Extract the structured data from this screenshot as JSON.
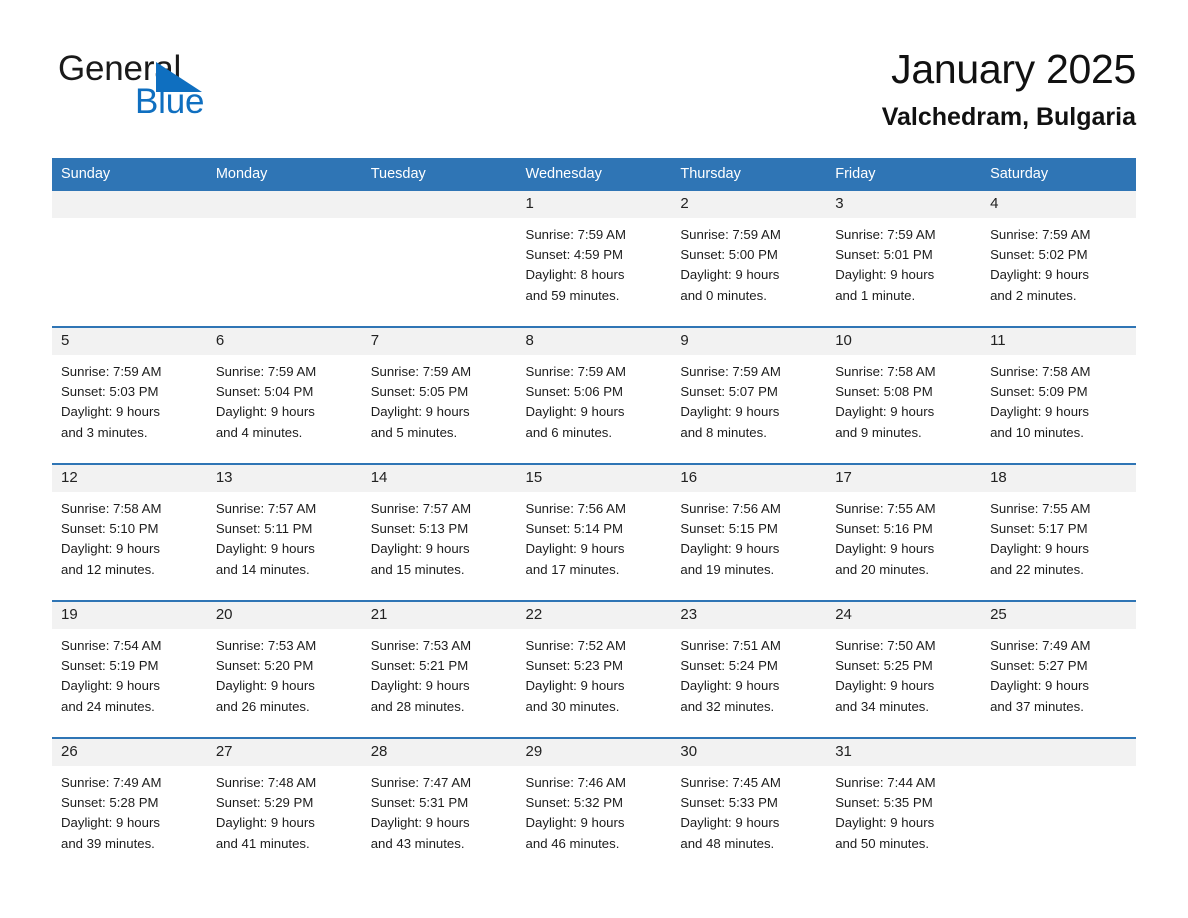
{
  "brand": {
    "line1": "General",
    "line2": "Blue",
    "flag_icon": "blue-triangle-flag-icon",
    "accent_color": "#0f6fc0"
  },
  "header": {
    "title": "January 2025",
    "location": "Valchedram, Bulgaria"
  },
  "colors": {
    "header_blue": "#2f75b5",
    "daynum_gray": "#f2f2f2",
    "text": "#1c1c1c"
  },
  "calendar": {
    "weekday_headers": [
      "Sunday",
      "Monday",
      "Tuesday",
      "Wednesday",
      "Thursday",
      "Friday",
      "Saturday"
    ],
    "weeks": [
      [
        {
          "day": "",
          "sunrise": "",
          "sunset": "",
          "daylight_line1": "",
          "daylight_line2": ""
        },
        {
          "day": "",
          "sunrise": "",
          "sunset": "",
          "daylight_line1": "",
          "daylight_line2": ""
        },
        {
          "day": "",
          "sunrise": "",
          "sunset": "",
          "daylight_line1": "",
          "daylight_line2": ""
        },
        {
          "day": "1",
          "sunrise": "Sunrise: 7:59 AM",
          "sunset": "Sunset: 4:59 PM",
          "daylight_line1": "Daylight: 8 hours",
          "daylight_line2": "and 59 minutes."
        },
        {
          "day": "2",
          "sunrise": "Sunrise: 7:59 AM",
          "sunset": "Sunset: 5:00 PM",
          "daylight_line1": "Daylight: 9 hours",
          "daylight_line2": "and 0 minutes."
        },
        {
          "day": "3",
          "sunrise": "Sunrise: 7:59 AM",
          "sunset": "Sunset: 5:01 PM",
          "daylight_line1": "Daylight: 9 hours",
          "daylight_line2": "and 1 minute."
        },
        {
          "day": "4",
          "sunrise": "Sunrise: 7:59 AM",
          "sunset": "Sunset: 5:02 PM",
          "daylight_line1": "Daylight: 9 hours",
          "daylight_line2": "and 2 minutes."
        }
      ],
      [
        {
          "day": "5",
          "sunrise": "Sunrise: 7:59 AM",
          "sunset": "Sunset: 5:03 PM",
          "daylight_line1": "Daylight: 9 hours",
          "daylight_line2": "and 3 minutes."
        },
        {
          "day": "6",
          "sunrise": "Sunrise: 7:59 AM",
          "sunset": "Sunset: 5:04 PM",
          "daylight_line1": "Daylight: 9 hours",
          "daylight_line2": "and 4 minutes."
        },
        {
          "day": "7",
          "sunrise": "Sunrise: 7:59 AM",
          "sunset": "Sunset: 5:05 PM",
          "daylight_line1": "Daylight: 9 hours",
          "daylight_line2": "and 5 minutes."
        },
        {
          "day": "8",
          "sunrise": "Sunrise: 7:59 AM",
          "sunset": "Sunset: 5:06 PM",
          "daylight_line1": "Daylight: 9 hours",
          "daylight_line2": "and 6 minutes."
        },
        {
          "day": "9",
          "sunrise": "Sunrise: 7:59 AM",
          "sunset": "Sunset: 5:07 PM",
          "daylight_line1": "Daylight: 9 hours",
          "daylight_line2": "and 8 minutes."
        },
        {
          "day": "10",
          "sunrise": "Sunrise: 7:58 AM",
          "sunset": "Sunset: 5:08 PM",
          "daylight_line1": "Daylight: 9 hours",
          "daylight_line2": "and 9 minutes."
        },
        {
          "day": "11",
          "sunrise": "Sunrise: 7:58 AM",
          "sunset": "Sunset: 5:09 PM",
          "daylight_line1": "Daylight: 9 hours",
          "daylight_line2": "and 10 minutes."
        }
      ],
      [
        {
          "day": "12",
          "sunrise": "Sunrise: 7:58 AM",
          "sunset": "Sunset: 5:10 PM",
          "daylight_line1": "Daylight: 9 hours",
          "daylight_line2": "and 12 minutes."
        },
        {
          "day": "13",
          "sunrise": "Sunrise: 7:57 AM",
          "sunset": "Sunset: 5:11 PM",
          "daylight_line1": "Daylight: 9 hours",
          "daylight_line2": "and 14 minutes."
        },
        {
          "day": "14",
          "sunrise": "Sunrise: 7:57 AM",
          "sunset": "Sunset: 5:13 PM",
          "daylight_line1": "Daylight: 9 hours",
          "daylight_line2": "and 15 minutes."
        },
        {
          "day": "15",
          "sunrise": "Sunrise: 7:56 AM",
          "sunset": "Sunset: 5:14 PM",
          "daylight_line1": "Daylight: 9 hours",
          "daylight_line2": "and 17 minutes."
        },
        {
          "day": "16",
          "sunrise": "Sunrise: 7:56 AM",
          "sunset": "Sunset: 5:15 PM",
          "daylight_line1": "Daylight: 9 hours",
          "daylight_line2": "and 19 minutes."
        },
        {
          "day": "17",
          "sunrise": "Sunrise: 7:55 AM",
          "sunset": "Sunset: 5:16 PM",
          "daylight_line1": "Daylight: 9 hours",
          "daylight_line2": "and 20 minutes."
        },
        {
          "day": "18",
          "sunrise": "Sunrise: 7:55 AM",
          "sunset": "Sunset: 5:17 PM",
          "daylight_line1": "Daylight: 9 hours",
          "daylight_line2": "and 22 minutes."
        }
      ],
      [
        {
          "day": "19",
          "sunrise": "Sunrise: 7:54 AM",
          "sunset": "Sunset: 5:19 PM",
          "daylight_line1": "Daylight: 9 hours",
          "daylight_line2": "and 24 minutes."
        },
        {
          "day": "20",
          "sunrise": "Sunrise: 7:53 AM",
          "sunset": "Sunset: 5:20 PM",
          "daylight_line1": "Daylight: 9 hours",
          "daylight_line2": "and 26 minutes."
        },
        {
          "day": "21",
          "sunrise": "Sunrise: 7:53 AM",
          "sunset": "Sunset: 5:21 PM",
          "daylight_line1": "Daylight: 9 hours",
          "daylight_line2": "and 28 minutes."
        },
        {
          "day": "22",
          "sunrise": "Sunrise: 7:52 AM",
          "sunset": "Sunset: 5:23 PM",
          "daylight_line1": "Daylight: 9 hours",
          "daylight_line2": "and 30 minutes."
        },
        {
          "day": "23",
          "sunrise": "Sunrise: 7:51 AM",
          "sunset": "Sunset: 5:24 PM",
          "daylight_line1": "Daylight: 9 hours",
          "daylight_line2": "and 32 minutes."
        },
        {
          "day": "24",
          "sunrise": "Sunrise: 7:50 AM",
          "sunset": "Sunset: 5:25 PM",
          "daylight_line1": "Daylight: 9 hours",
          "daylight_line2": "and 34 minutes."
        },
        {
          "day": "25",
          "sunrise": "Sunrise: 7:49 AM",
          "sunset": "Sunset: 5:27 PM",
          "daylight_line1": "Daylight: 9 hours",
          "daylight_line2": "and 37 minutes."
        }
      ],
      [
        {
          "day": "26",
          "sunrise": "Sunrise: 7:49 AM",
          "sunset": "Sunset: 5:28 PM",
          "daylight_line1": "Daylight: 9 hours",
          "daylight_line2": "and 39 minutes."
        },
        {
          "day": "27",
          "sunrise": "Sunrise: 7:48 AM",
          "sunset": "Sunset: 5:29 PM",
          "daylight_line1": "Daylight: 9 hours",
          "daylight_line2": "and 41 minutes."
        },
        {
          "day": "28",
          "sunrise": "Sunrise: 7:47 AM",
          "sunset": "Sunset: 5:31 PM",
          "daylight_line1": "Daylight: 9 hours",
          "daylight_line2": "and 43 minutes."
        },
        {
          "day": "29",
          "sunrise": "Sunrise: 7:46 AM",
          "sunset": "Sunset: 5:32 PM",
          "daylight_line1": "Daylight: 9 hours",
          "daylight_line2": "and 46 minutes."
        },
        {
          "day": "30",
          "sunrise": "Sunrise: 7:45 AM",
          "sunset": "Sunset: 5:33 PM",
          "daylight_line1": "Daylight: 9 hours",
          "daylight_line2": "and 48 minutes."
        },
        {
          "day": "31",
          "sunrise": "Sunrise: 7:44 AM",
          "sunset": "Sunset: 5:35 PM",
          "daylight_line1": "Daylight: 9 hours",
          "daylight_line2": "and 50 minutes."
        },
        {
          "day": "",
          "sunrise": "",
          "sunset": "",
          "daylight_line1": "",
          "daylight_line2": ""
        }
      ]
    ]
  }
}
